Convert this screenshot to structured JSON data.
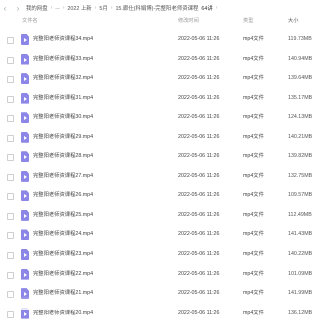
{
  "breadcrumb": {
    "nav_more": "...",
    "items": [
      "我的网盘",
      "...",
      "2022 上新",
      "5月",
      "15.廊仕(科娟博)-完整阳老师资课程",
      "64讲"
    ]
  },
  "columns": {
    "name": "文件名",
    "time": "修改时间",
    "type": "类型",
    "size": "大小"
  },
  "files": [
    {
      "name": "完整阳老师资课程34.mp4",
      "time": "2022-05-06 11:26",
      "type": "mp4文件",
      "size": "119.73MB"
    },
    {
      "name": "完整阳老师资课程33.mp4",
      "time": "2022-05-06 11:26",
      "type": "mp4文件",
      "size": "140.94MB"
    },
    {
      "name": "完整阳老师资课程32.mp4",
      "time": "2022-05-06 11:26",
      "type": "mp4文件",
      "size": "139.64MB"
    },
    {
      "name": "完整阳老师资课程31.mp4",
      "time": "2022-05-06 11:26",
      "type": "mp4文件",
      "size": "135.17MB"
    },
    {
      "name": "完整阳老师资课程30.mp4",
      "time": "2022-05-06 11:26",
      "type": "mp4文件",
      "size": "124.13MB"
    },
    {
      "name": "完整阳老师资课程29.mp4",
      "time": "2022-05-06 11:26",
      "type": "mp4文件",
      "size": "140.21MB"
    },
    {
      "name": "完整阳老师资课程28.mp4",
      "time": "2022-05-06 11:26",
      "type": "mp4文件",
      "size": "139.82MB"
    },
    {
      "name": "完整阳老师资课程27.mp4",
      "time": "2022-05-06 11:26",
      "type": "mp4文件",
      "size": "132.75MB"
    },
    {
      "name": "完整阳老师资课程26.mp4",
      "time": "2022-05-06 11:26",
      "type": "mp4文件",
      "size": "109.57MB"
    },
    {
      "name": "完整阳老师资课程25.mp4",
      "time": "2022-05-06 11:26",
      "type": "mp4文件",
      "size": "112.49MB"
    },
    {
      "name": "完整阳老师资课程24.mp4",
      "time": "2022-05-06 11:26",
      "type": "mp4文件",
      "size": "141.43MB"
    },
    {
      "name": "完整阳老师资课程23.mp4",
      "time": "2022-05-06 11:26",
      "type": "mp4文件",
      "size": "140.22MB"
    },
    {
      "name": "完整阳老师资课程22.mp4",
      "time": "2022-05-06 11:26",
      "type": "mp4文件",
      "size": "101.09MB"
    },
    {
      "name": "完整阳老师资课程21.mp4",
      "time": "2022-05-06 11:26",
      "type": "mp4文件",
      "size": "141.99MB"
    },
    {
      "name": "完整阳老师资课程20.mp4",
      "time": "2022-05-06 11:26",
      "type": "mp4文件",
      "size": "136.12MB"
    }
  ]
}
